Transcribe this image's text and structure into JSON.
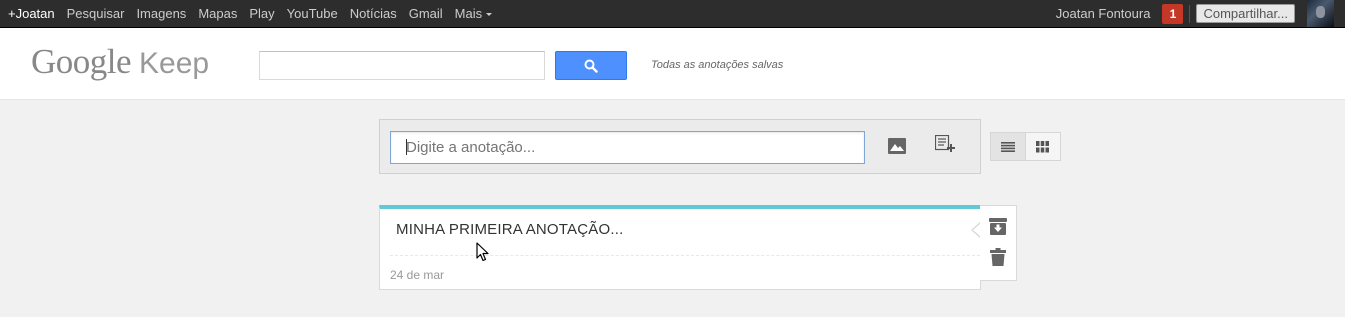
{
  "gbar": {
    "nav": [
      "+Joatan",
      "Pesquisar",
      "Imagens",
      "Mapas",
      "Play",
      "YouTube",
      "Notícias",
      "Gmail"
    ],
    "more_label": "Mais",
    "user_name": "Joatan Fontoura",
    "notification_count": "1",
    "share_label": "Compartilhar..."
  },
  "header": {
    "logo_google": "Google",
    "logo_keep": "Keep",
    "search_placeholder": "",
    "search_icon": "search-icon",
    "saved_status": "Todas as anotações salvas"
  },
  "composer": {
    "placeholder": "Digite a anotação...",
    "image_icon": "image-icon",
    "list_icon": "add-list-icon"
  },
  "view_toggle": {
    "options": [
      "list-view",
      "grid-view"
    ],
    "selected": "list-view"
  },
  "notes": [
    {
      "title": "MINHA PRIMEIRA ANOTAÇÃO...",
      "date": "24 de mar",
      "color": "#62c7d9"
    }
  ],
  "note_actions": [
    "archive-icon",
    "trash-icon"
  ],
  "colors": {
    "accent": "#4d90fe",
    "note_stripe": "#62c7d9",
    "notification": "#c53727"
  }
}
